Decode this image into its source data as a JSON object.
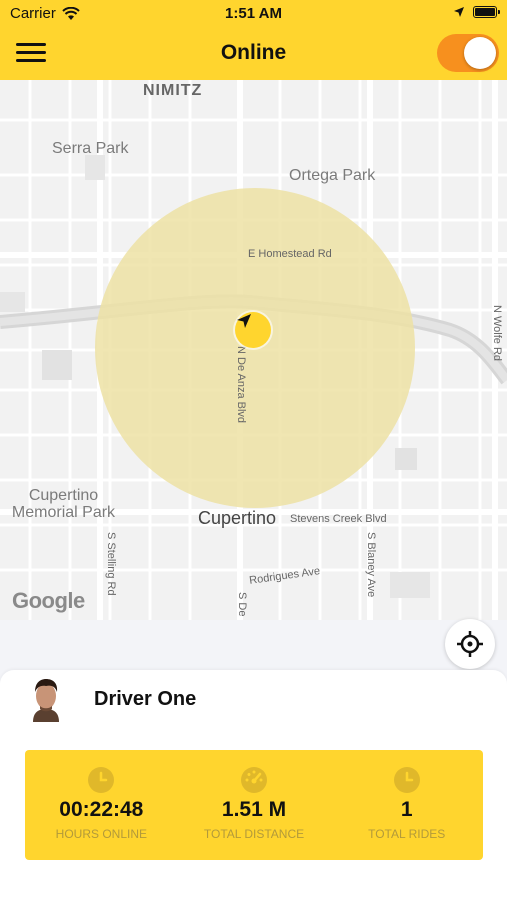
{
  "status_bar": {
    "carrier": "Carrier",
    "time": "1:51 AM",
    "icons": [
      "wifi-icon",
      "location-arrow-icon",
      "battery-icon"
    ]
  },
  "header": {
    "title": "Online",
    "menu_icon": "hamburger-menu-icon",
    "online_toggle": true,
    "accent_color": "#FFD52E",
    "toggle_color": "#F7901E"
  },
  "map": {
    "labels": {
      "nimitz": "NIMITZ",
      "serra_park": "Serra Park",
      "ortega_park": "Ortega Park",
      "homestead": "E Homestead Rd",
      "de_anza": "N De Anza Blvd",
      "wolfe": "N Wolfe Rd",
      "cupertino_memorial": "Cupertino Memorial Park",
      "cupertino": "Cupertino",
      "stevens_creek": "Stevens Creek Blvd",
      "stelling": "S Stelling Rd",
      "blaney": "S Blaney Ave",
      "rodrigues": "Rodrigues Ave",
      "s_de": "S De",
      "google": "Google"
    },
    "radius_color": "#EDE2A4",
    "pin_icon": "navigation-arrow-icon",
    "recenter_icon": "crosshair-icon"
  },
  "driver": {
    "name": "Driver One",
    "avatar": "driver-avatar"
  },
  "stats": [
    {
      "icon": "clock-icon",
      "value": "00:22:48",
      "label": "HOURS ONLINE"
    },
    {
      "icon": "speedometer-icon",
      "value": "1.51 M",
      "label": "TOTAL DISTANCE"
    },
    {
      "icon": "clock-icon",
      "value": "1",
      "label": "TOTAL RIDES"
    }
  ]
}
